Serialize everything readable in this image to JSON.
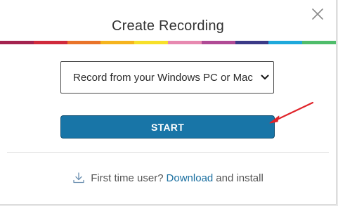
{
  "dialog": {
    "title": "Create Recording",
    "close_icon": "close-icon",
    "rainbow_colors": [
      "#a4234f",
      "#d02a3c",
      "#e9742a",
      "#f5b41e",
      "#f7e02a",
      "#e789b0",
      "#b04a95",
      "#3b3a87",
      "#1ea9db",
      "#4fbd6b"
    ]
  },
  "recording_source": {
    "selected": "Record from your Windows PC or Mac",
    "chevron_icon": "chevron-down-icon"
  },
  "start_button": {
    "label": "START",
    "color": "#1875a7"
  },
  "annotation": {
    "icon": "red-arrow-icon",
    "color": "#e0242a"
  },
  "footer": {
    "icon": "download-icon",
    "prefix": "First time user?",
    "link": "Download",
    "suffix": "and install"
  }
}
